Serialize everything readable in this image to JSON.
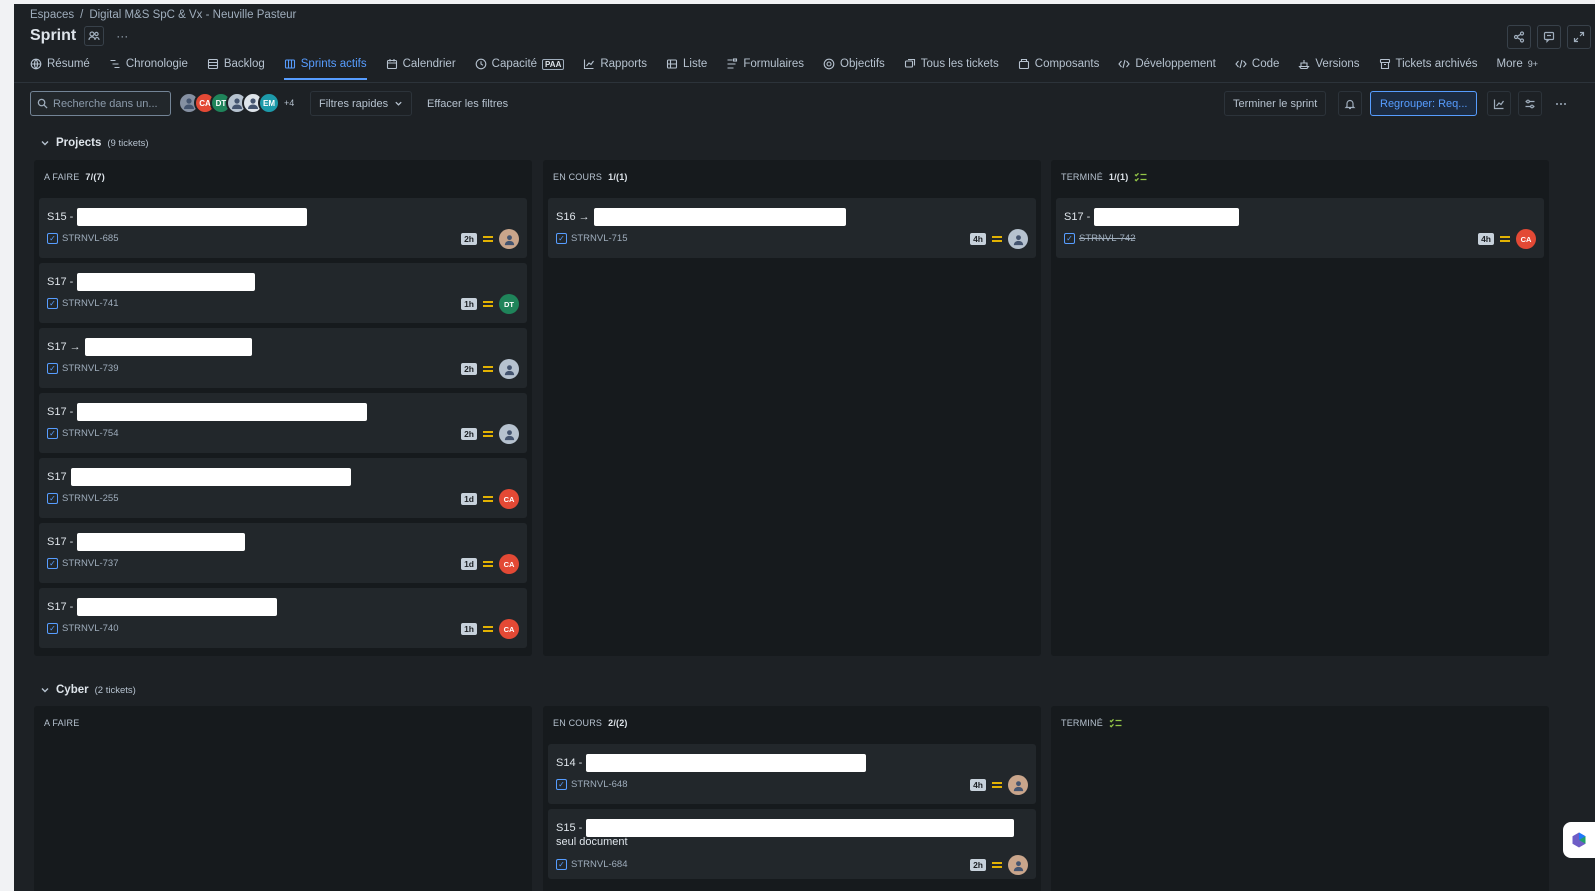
{
  "breadcrumb": {
    "root": "Espaces",
    "separator": "/",
    "project": "Digital M&S SpC & Vx - Neuville Pasteur"
  },
  "page": {
    "title": "Sprint",
    "more": "···"
  },
  "tabs": [
    {
      "label": "Résumé",
      "icon": "globe-icon",
      "active": false
    },
    {
      "label": "Chronologie",
      "icon": "timeline-icon",
      "active": false
    },
    {
      "label": "Backlog",
      "icon": "backlog-icon",
      "active": false
    },
    {
      "label": "Sprints actifs",
      "icon": "board-icon",
      "active": true
    },
    {
      "label": "Calendrier",
      "icon": "calendar-icon",
      "active": false
    },
    {
      "label": "Capacité",
      "icon": "clock-icon",
      "badge": "PAA",
      "active": false
    },
    {
      "label": "Rapports",
      "icon": "chart-icon",
      "active": false
    },
    {
      "label": "Liste",
      "icon": "list-icon",
      "active": false
    },
    {
      "label": "Formulaires",
      "icon": "form-icon",
      "active": false
    },
    {
      "label": "Objectifs",
      "icon": "target-icon",
      "active": false
    },
    {
      "label": "Tous les tickets",
      "icon": "tickets-icon",
      "active": false
    },
    {
      "label": "Composants",
      "icon": "component-icon",
      "active": false
    },
    {
      "label": "Développement",
      "icon": "code-icon",
      "active": false
    },
    {
      "label": "Code",
      "icon": "code-icon",
      "active": false
    },
    {
      "label": "Versions",
      "icon": "ship-icon",
      "active": false
    },
    {
      "label": "Tickets archivés",
      "icon": "archive-icon",
      "active": false
    },
    {
      "label": "More",
      "icon": "",
      "badge": "9+",
      "active": false
    }
  ],
  "toolbar": {
    "search_placeholder": "Recherche dans un...",
    "avatars": [
      {
        "initials": "",
        "color": "#8590a2"
      },
      {
        "initials": "CA",
        "color": "#e34935"
      },
      {
        "initials": "DT",
        "color": "#1f845a"
      },
      {
        "initials": "",
        "color": "#b6c2cf"
      },
      {
        "initials": "",
        "color": "#dee4ea"
      },
      {
        "initials": "EM",
        "color": "#1d9aaa"
      }
    ],
    "avatars_more": "+4",
    "quick_filters": "Filtres rapides",
    "clear_filters": "Effacer les filtres",
    "complete_sprint": "Terminer le sprint",
    "group_by": "Regrouper: Req..."
  },
  "lanes": [
    {
      "name": "Projects",
      "count": "(9 tickets)",
      "columns": [
        {
          "title": "A FAIRE",
          "count": "7/(7)",
          "cards": [
            {
              "prefix": "S15 -",
              "redact": 230,
              "key": "STRNVL-685",
              "est": "2h",
              "assignee": {
                "initials": "",
                "color": "#c9a58b"
              }
            },
            {
              "prefix": "S17 -",
              "redact": 178,
              "key": "STRNVL-741",
              "est": "1h",
              "assignee": {
                "initials": "DT",
                "color": "#1f845a"
              }
            },
            {
              "prefix": "S17 →",
              "redact": 167,
              "key": "STRNVL-739",
              "est": "2h",
              "assignee": {
                "initials": "",
                "color": "#b6c2cf"
              }
            },
            {
              "prefix": "S17 -",
              "redact": 290,
              "key": "STRNVL-754",
              "est": "2h",
              "assignee": {
                "initials": "",
                "color": "#b6c2cf"
              }
            },
            {
              "prefix": "S17",
              "redact": 280,
              "key": "STRNVL-255",
              "est": "1d",
              "assignee": {
                "initials": "CA",
                "color": "#e34935"
              }
            },
            {
              "prefix": "S17 -",
              "redact": 168,
              "key": "STRNVL-737",
              "est": "1d",
              "assignee": {
                "initials": "CA",
                "color": "#e34935"
              }
            },
            {
              "prefix": "S17 -",
              "redact": 200,
              "key": "STRNVL-740",
              "est": "1h",
              "assignee": {
                "initials": "CA",
                "color": "#e34935"
              }
            }
          ]
        },
        {
          "title": "EN COURS",
          "count": "1/(1)",
          "cards": [
            {
              "prefix": "S16 →",
              "redact": 252,
              "key": "STRNVL-715",
              "est": "4h",
              "assignee": {
                "initials": "",
                "color": "#b6c2cf"
              }
            }
          ]
        },
        {
          "title": "TERMINÉ",
          "count": "1/(1)",
          "cards": [
            {
              "prefix": "S17 -",
              "redact": 145,
              "key": "STRNVL-742",
              "est": "4h",
              "done": true,
              "assignee": {
                "initials": "CA",
                "color": "#e34935"
              }
            }
          ]
        }
      ]
    },
    {
      "name": "Cyber",
      "count": "(2 tickets)",
      "columns": [
        {
          "title": "A FAIRE",
          "count": "",
          "cards": []
        },
        {
          "title": "EN COURS",
          "count": "2/(2)",
          "cards": [
            {
              "prefix": "S14 -",
              "redact": 280,
              "key": "STRNVL-648",
              "est": "4h",
              "assignee": {
                "initials": "",
                "color": "#c9a58b"
              }
            },
            {
              "prefix": "S15 -",
              "redact": 428,
              "sub": "seul document",
              "key": "STRNVL-684",
              "est": "2h",
              "assignee": {
                "initials": "",
                "color": "#c9a58b"
              }
            }
          ]
        },
        {
          "title": "TERMINÉ",
          "count": "",
          "cards": []
        }
      ]
    }
  ]
}
